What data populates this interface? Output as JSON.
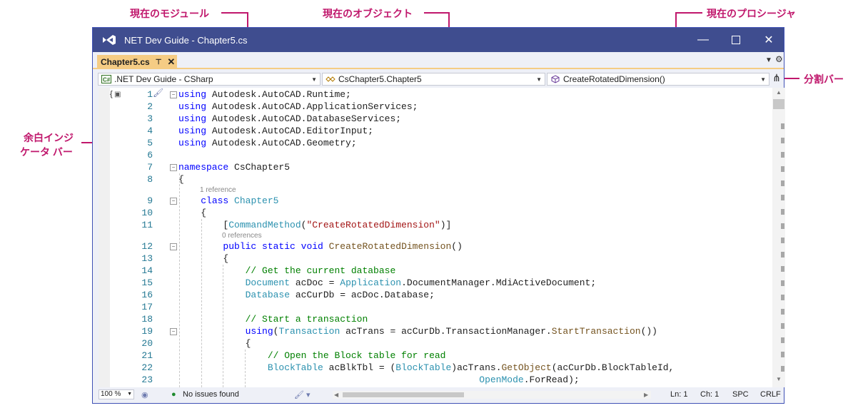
{
  "callouts": {
    "current_module": "現在のモジュール",
    "current_object": "現在のオブジェクト",
    "current_procedure": "現在のプロシージャ",
    "splitter_bar": "分割バー",
    "margin_line1": "余白インジ",
    "margin_line2": "ケータ バー"
  },
  "window": {
    "title": "NET Dev Guide - Chapter5.cs"
  },
  "tab": {
    "label": "Chapter5.cs"
  },
  "nav": {
    "module": ".NET Dev Guide - CSharp",
    "object": "CsChapter5.Chapter5",
    "procedure": "CreateRotatedDimension()"
  },
  "code": {
    "lines": [
      {
        "n": "1",
        "t": [
          [
            "kw",
            "using"
          ],
          [
            "",
            "Autodesk.AutoCAD.Runtime;"
          ]
        ]
      },
      {
        "n": "2",
        "t": [
          [
            "kw",
            "using"
          ],
          [
            "",
            "Autodesk.AutoCAD.ApplicationServices;"
          ]
        ]
      },
      {
        "n": "3",
        "t": [
          [
            "kw",
            "using"
          ],
          [
            "",
            "Autodesk.AutoCAD.DatabaseServices;"
          ]
        ]
      },
      {
        "n": "4",
        "t": [
          [
            "kw",
            "using"
          ],
          [
            "",
            "Autodesk.AutoCAD.EditorInput;"
          ]
        ]
      },
      {
        "n": "5",
        "t": [
          [
            "kw",
            "using"
          ],
          [
            "",
            "Autodesk.AutoCAD.Geometry;"
          ]
        ]
      },
      {
        "n": "6",
        "t": []
      },
      {
        "n": "7",
        "t": [
          [
            "kw",
            "namespace"
          ],
          [
            "",
            "CsChapter5"
          ]
        ]
      },
      {
        "n": "8",
        "t": [
          [
            "",
            "{"
          ]
        ]
      },
      {
        "n": "9",
        "t": [
          [
            "",
            "    "
          ],
          [
            "kw",
            "class"
          ],
          [
            "ty",
            "Chapter5"
          ]
        ]
      },
      {
        "n": "10",
        "t": [
          [
            "",
            "    {"
          ]
        ]
      },
      {
        "n": "11",
        "t": [
          [
            "",
            "        ["
          ],
          [
            "ty",
            "CommandMethod"
          ],
          [
            "",
            "("
          ],
          [
            "st",
            "\"CreateRotatedDimension\""
          ],
          [
            "",
            ")]"
          ]
        ]
      },
      {
        "n": "12",
        "t": [
          [
            "",
            "        "
          ],
          [
            "kw",
            "public static void"
          ],
          [
            "mt",
            "CreateRotatedDimension"
          ],
          [
            "",
            "()"
          ]
        ]
      },
      {
        "n": "13",
        "t": [
          [
            "",
            "        {"
          ]
        ]
      },
      {
        "n": "14",
        "t": [
          [
            "",
            "            "
          ],
          [
            "cm",
            "// Get the current database"
          ]
        ]
      },
      {
        "n": "15",
        "t": [
          [
            "",
            "            "
          ],
          [
            "ty",
            "Document"
          ],
          [
            "",
            "acDoc = "
          ],
          [
            "ty",
            "Application"
          ],
          [
            "",
            ".DocumentManager.MdiActiveDocument;"
          ]
        ]
      },
      {
        "n": "16",
        "t": [
          [
            "",
            "            "
          ],
          [
            "ty",
            "Database"
          ],
          [
            "",
            "acCurDb = acDoc.Database;"
          ]
        ]
      },
      {
        "n": "17",
        "t": []
      },
      {
        "n": "18",
        "t": [
          [
            "",
            "            "
          ],
          [
            "cm",
            "// Start a transaction"
          ]
        ]
      },
      {
        "n": "19",
        "t": [
          [
            "",
            "            "
          ],
          [
            "kw",
            "using"
          ],
          [
            "",
            "("
          ],
          [
            "ty",
            "Transaction"
          ],
          [
            "",
            "acTrans = acCurDb.TransactionManager."
          ],
          [
            "mt",
            "StartTransaction"
          ],
          [
            "",
            "())"
          ]
        ]
      },
      {
        "n": "20",
        "t": [
          [
            "",
            "            {"
          ]
        ]
      },
      {
        "n": "21",
        "t": [
          [
            "",
            "                "
          ],
          [
            "cm",
            "// Open the Block table for read"
          ]
        ]
      },
      {
        "n": "22",
        "t": [
          [
            "",
            "                "
          ],
          [
            "ty",
            "BlockTable"
          ],
          [
            "",
            "acBlkTbl = ("
          ],
          [
            "ty",
            "BlockTable"
          ],
          [
            "",
            ")acTrans."
          ],
          [
            "mt",
            "GetObject"
          ],
          [
            "",
            "(acCurDb.BlockTableId,"
          ]
        ]
      },
      {
        "n": "23",
        "t": [
          [
            "",
            "                                                      "
          ],
          [
            "ty",
            "OpenMode"
          ],
          [
            "",
            ".ForRead);"
          ]
        ]
      }
    ],
    "lens": [
      "1 reference",
      "0 references"
    ]
  },
  "status": {
    "zoom": "100 %",
    "issues": "No issues found",
    "ln": "Ln: 1",
    "ch": "Ch: 1",
    "spc": "SPC",
    "crlf": "CRLF"
  }
}
